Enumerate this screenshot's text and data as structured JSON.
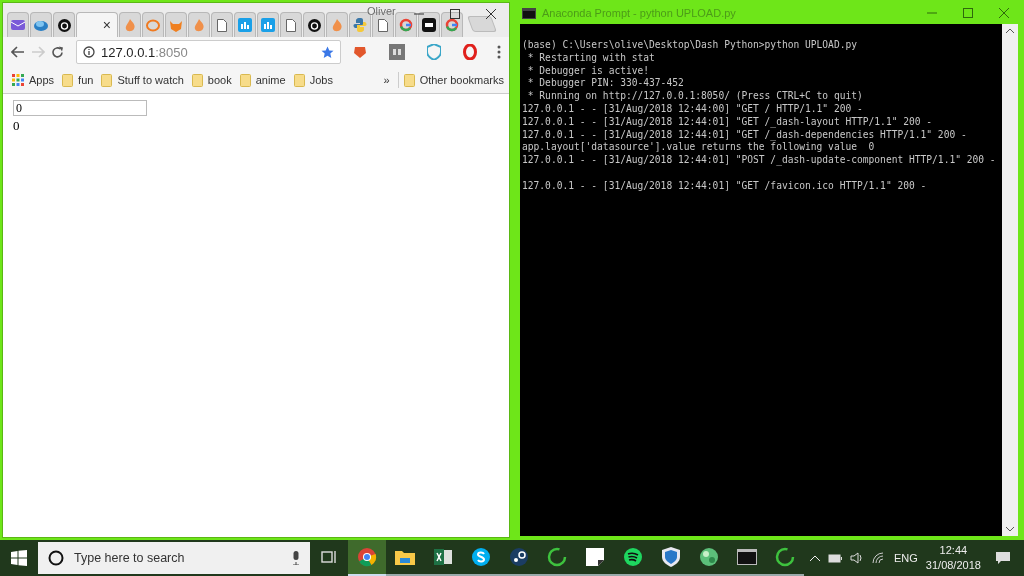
{
  "browser": {
    "profile": "Oliver",
    "tabs": [
      {
        "kind": "mail",
        "selected": false
      },
      {
        "kind": "cloud",
        "selected": false
      },
      {
        "kind": "github",
        "selected": false
      },
      {
        "selected": true,
        "close": "×"
      },
      {
        "kind": "flame",
        "selected": false
      },
      {
        "kind": "ring",
        "selected": false
      },
      {
        "kind": "fox",
        "selected": false
      },
      {
        "kind": "flame",
        "selected": false
      },
      {
        "kind": "page",
        "selected": false
      },
      {
        "kind": "chart",
        "selected": false
      },
      {
        "kind": "chart",
        "selected": false
      },
      {
        "kind": "page",
        "selected": false
      },
      {
        "kind": "github",
        "selected": false
      },
      {
        "kind": "flame",
        "selected": false
      },
      {
        "kind": "python",
        "selected": false
      },
      {
        "kind": "page",
        "selected": false
      },
      {
        "kind": "google",
        "selected": false
      },
      {
        "kind": "htg",
        "selected": false
      },
      {
        "kind": "google",
        "selected": false
      }
    ],
    "url_host": "127.0.0.1",
    "url_port": ":8050",
    "bookmarks": [
      {
        "kind": "apps",
        "label": "Apps"
      },
      {
        "kind": "folder",
        "label": "fun"
      },
      {
        "kind": "folder",
        "label": "Stuff to watch"
      },
      {
        "kind": "folder",
        "label": "book"
      },
      {
        "kind": "folder",
        "label": "anime"
      },
      {
        "kind": "folder",
        "label": "Jobs"
      }
    ],
    "more": "»",
    "other_bookmarks": "Other bookmarks",
    "page": {
      "input_value": "0",
      "output": "0"
    }
  },
  "terminal": {
    "title": "Anaconda Prompt - python  UPLOAD.py",
    "blocks": [
      [
        "(base) C:\\Users\\olive\\Desktop\\Dash Python>python UPLOAD.py",
        " * Restarting with stat",
        " * Debugger is active!",
        " * Debugger PIN: 330-437-452",
        " * Running on http://127.0.0.1:8050/ (Press CTRL+C to quit)",
        "127.0.0.1 - - [31/Aug/2018 12:44:00] \"GET / HTTP/1.1\" 200 -",
        "127.0.0.1 - - [31/Aug/2018 12:44:01] \"GET /_dash-layout HTTP/1.1\" 200 -",
        "127.0.0.1 - - [31/Aug/2018 12:44:01] \"GET /_dash-dependencies HTTP/1.1\" 200 -",
        "app.layout['datasource'].value returns the following value  0",
        "127.0.0.1 - - [31/Aug/2018 12:44:01] \"POST /_dash-update-component HTTP/1.1\" 200 -"
      ],
      [
        "127.0.0.1 - - [31/Aug/2018 12:44:01] \"GET /favicon.ico HTTP/1.1\" 200 -"
      ]
    ]
  },
  "taskbar": {
    "search_placeholder": "Type here to search",
    "apps": [
      {
        "kind": "chrome",
        "selected": true
      },
      {
        "kind": "explorer",
        "selected": false
      },
      {
        "kind": "excel",
        "selected": false
      },
      {
        "kind": "skype",
        "selected": false
      },
      {
        "kind": "steam",
        "selected": false
      },
      {
        "kind": "ring",
        "selected": false
      },
      {
        "kind": "sticky",
        "selected": false
      },
      {
        "kind": "spotify",
        "selected": false
      },
      {
        "kind": "shield",
        "selected": false
      },
      {
        "kind": "globe",
        "selected": false
      },
      {
        "kind": "terminal",
        "selected": false
      },
      {
        "kind": "ring",
        "selected": false
      }
    ],
    "language": "ENG",
    "time": "12:44",
    "date": "31/08/2018"
  }
}
